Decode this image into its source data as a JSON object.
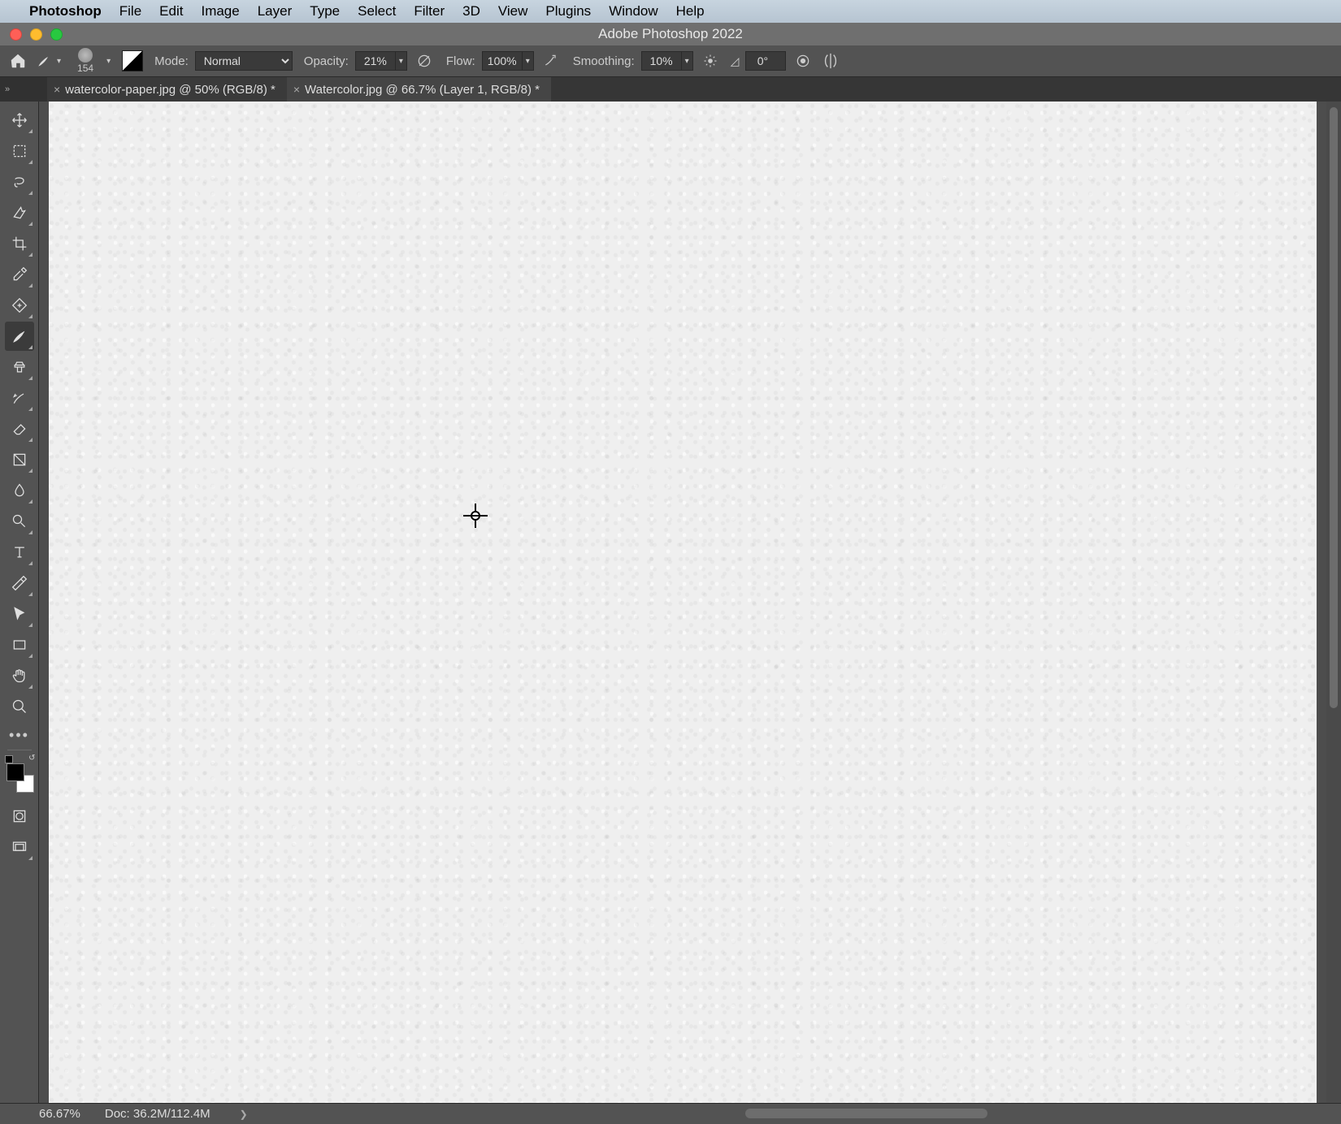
{
  "mac_menu": {
    "app_name": "Photoshop",
    "items": [
      "File",
      "Edit",
      "Image",
      "Layer",
      "Type",
      "Select",
      "Filter",
      "3D",
      "View",
      "Plugins",
      "Window",
      "Help"
    ]
  },
  "window": {
    "title": "Adobe Photoshop 2022"
  },
  "options_bar": {
    "brush_size": "154",
    "mode_label": "Mode:",
    "mode_value": "Normal",
    "opacity_label": "Opacity:",
    "opacity_value": "21%",
    "flow_label": "Flow:",
    "flow_value": "100%",
    "smoothing_label": "Smoothing:",
    "smoothing_value": "10%",
    "angle_value": "0°"
  },
  "tabs": [
    {
      "label": "watercolor-paper.jpg @ 50% (RGB/8) *",
      "active": false
    },
    {
      "label": "Watercolor.jpg @ 66.7% (Layer 1, RGB/8) *",
      "active": true
    }
  ],
  "status": {
    "zoom": "66.67%",
    "doc": "Doc: 36.2M/112.4M"
  },
  "colors": {
    "foreground": "#000000",
    "background": "#ffffff"
  }
}
